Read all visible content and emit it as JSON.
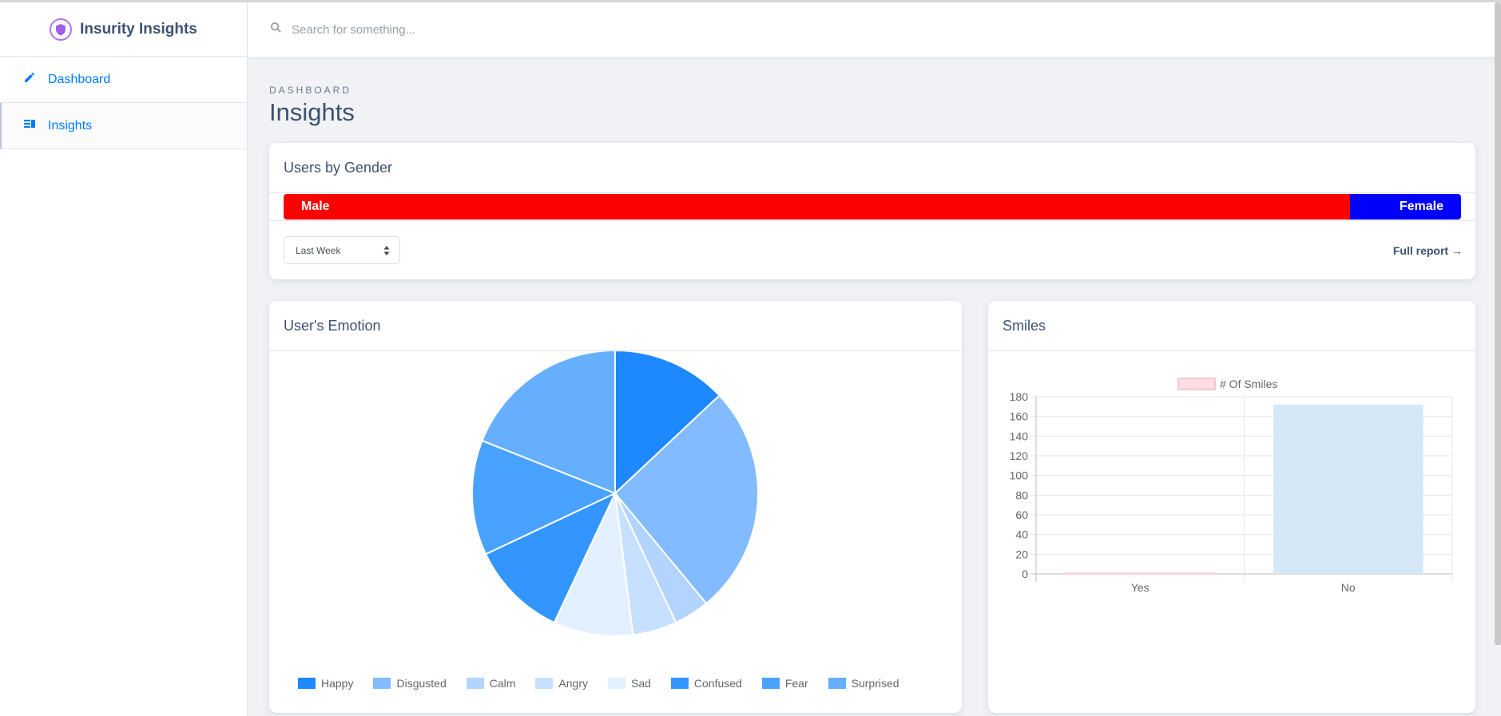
{
  "app": {
    "name": "Insurity Insights"
  },
  "sidebar": {
    "items": [
      {
        "label": "Dashboard",
        "icon": "pencil-icon"
      },
      {
        "label": "Insights",
        "icon": "view-list-icon",
        "active": true
      }
    ]
  },
  "header": {
    "search_placeholder": "Search for something..."
  },
  "page": {
    "subtitle": "DASHBOARD",
    "title": "Insights"
  },
  "gender_card": {
    "title": "Users by Gender",
    "male_label": "Male",
    "female_label": "Female",
    "male_share": 0.906,
    "female_share": 0.094,
    "male_color": "#ff0000",
    "female_color": "#0000ff",
    "range_value": "Last Week",
    "full_report": "Full report →"
  },
  "emotion_card": {
    "title": "User's Emotion"
  },
  "smiles_card": {
    "title": "Smiles"
  },
  "chart_data": [
    {
      "type": "pie",
      "categories": [
        "Happy",
        "Disgusted",
        "Calm",
        "Angry",
        "Sad",
        "Confused",
        "Fear",
        "Surprised"
      ],
      "values": [
        13,
        26,
        4,
        5,
        9,
        11,
        13,
        19
      ],
      "colors": [
        "#1e88ff",
        "#82bbff",
        "#b3d4ff",
        "#c7e0ff",
        "#e3f0ff",
        "#3396ff",
        "#4aa2ff",
        "#66afff"
      ],
      "legend": "bottom"
    },
    {
      "type": "bar",
      "categories": [
        "Yes",
        "No"
      ],
      "series": [
        {
          "name": "# Of Smiles",
          "values": [
            1,
            172
          ]
        }
      ],
      "bar_colors": [
        "#ffdde3",
        "#d4e8f7"
      ],
      "yticks": [
        0,
        20,
        40,
        60,
        80,
        100,
        120,
        140,
        160,
        180
      ],
      "ylim": [
        0,
        180
      ],
      "grid": true,
      "legend": "top"
    }
  ]
}
